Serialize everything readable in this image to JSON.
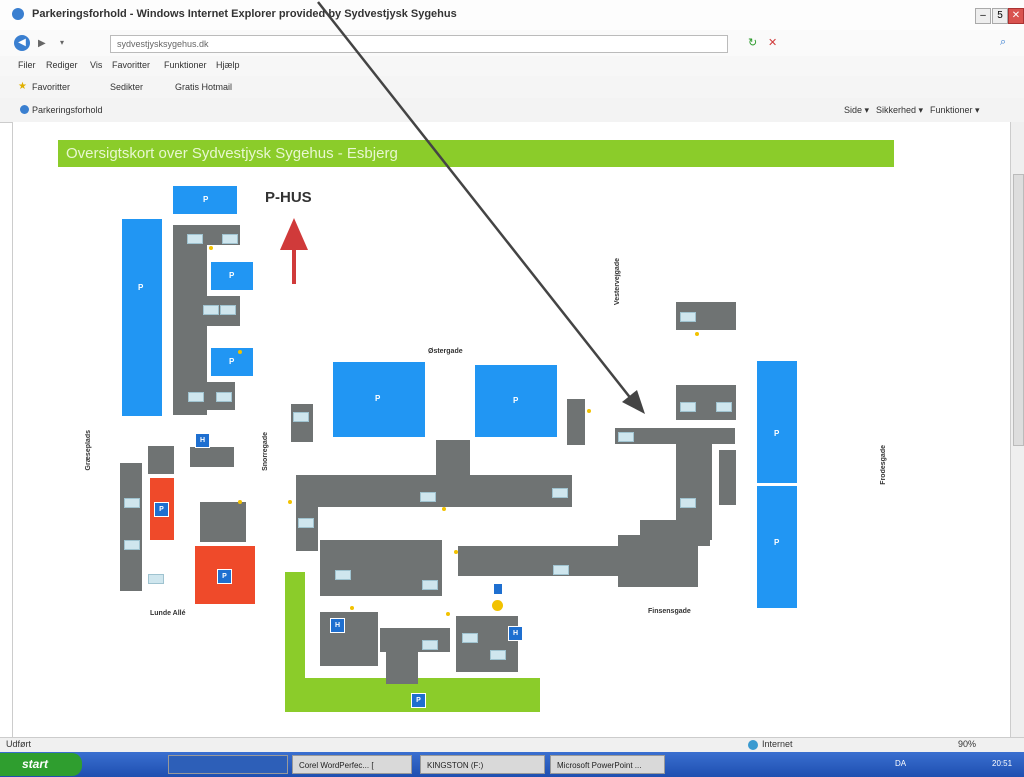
{
  "window": {
    "title": "Parkeringsforhold - Windows Internet Explorer provided by Sydvestjysk Sygehus"
  },
  "address": {
    "url": "sydvestjysksygehus.dk"
  },
  "menu": [
    "Filer",
    "Rediger",
    "Vis",
    "Favoritter",
    "Funktioner",
    "Hjælp"
  ],
  "favorites": {
    "label": "Favoritter",
    "links": [
      "Sedikter",
      "Gratis Hotmail"
    ]
  },
  "tab": {
    "label": "Parkeringsforhold"
  },
  "command_bar": [
    "Side ▾",
    "Sikkerhed ▾",
    "Funktioner ▾"
  ],
  "map": {
    "header": "Oversigtskort over Sydvestjysk Sygehus - Esbjerg",
    "p_hus": "P-HUS",
    "parking_label": "P",
    "hospice_label": "H",
    "streets": {
      "finsensgade": "Finsensgade",
      "lunde_alle": "Lunde Allé",
      "ostergade": "Østergade",
      "frodesgade": "Frodesgade",
      "vestergade_top": "Vestervejgade",
      "graeseplads": "Græseplads",
      "snorre": "Snorregade"
    }
  },
  "status": {
    "left": "Udført",
    "zone": "Internet",
    "zoom": "90%"
  },
  "taskbar": {
    "start": "start",
    "tasks": [
      "Corel WordPerfec... [",
      "KINGSTON (F:)",
      "Microsoft PowerPoint ..."
    ],
    "lang": "DA",
    "clock": "20:51"
  },
  "colors": {
    "parking": "#2196f3",
    "building": "#6f7373",
    "green": "#8bcc2a",
    "red_parking": "#ef4a2a",
    "arrow": "#d03a3a"
  }
}
